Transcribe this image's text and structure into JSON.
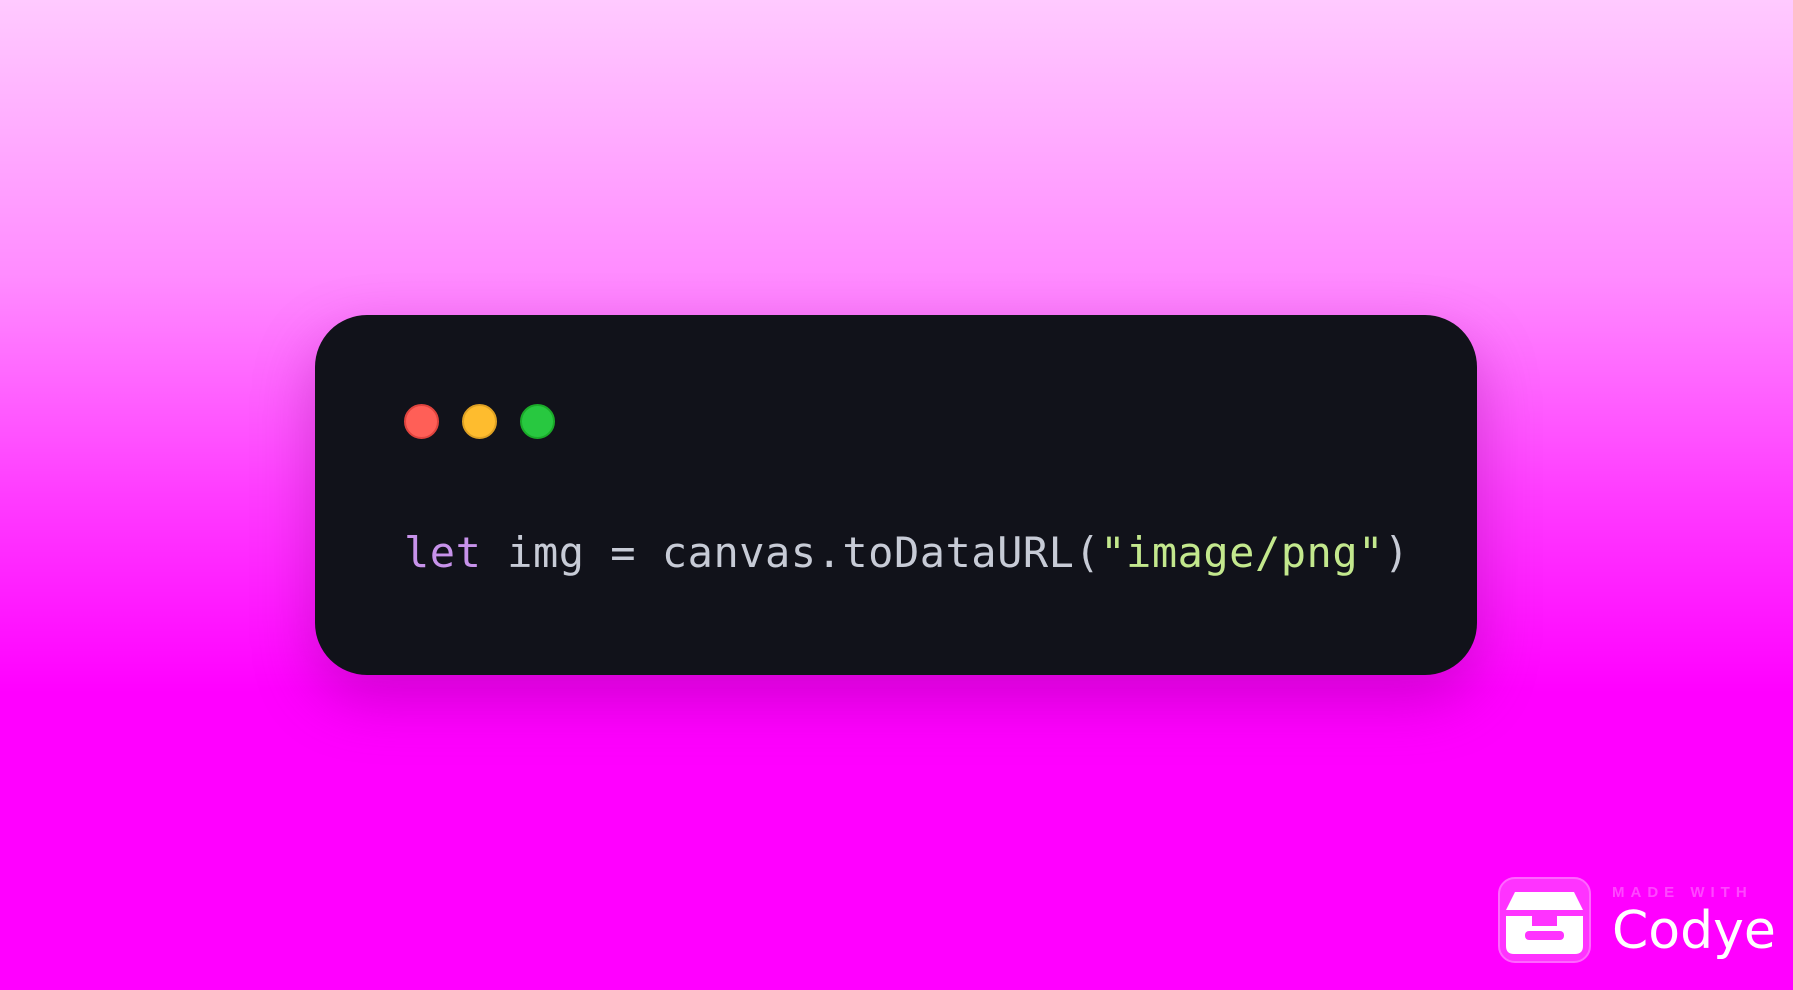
{
  "window": {
    "traffic_lights": [
      {
        "name": "close",
        "color": "#ff5f57"
      },
      {
        "name": "minimize",
        "color": "#febc2e"
      },
      {
        "name": "zoom",
        "color": "#28c840"
      }
    ]
  },
  "code": {
    "keyword": "let",
    "space1": " ",
    "part1": "img = canvas.toDataURL(",
    "string": "\"image/png\"",
    "part2": ")"
  },
  "badge": {
    "made_with": "MADE WITH",
    "brand": "Codye",
    "icon": "inbox-tray-icon"
  },
  "colors": {
    "keyword": "#c792ea",
    "plain": "#c7cbd6",
    "string": "#c3e88d",
    "window_bg": "#11121a",
    "background": "#ff00ff"
  }
}
